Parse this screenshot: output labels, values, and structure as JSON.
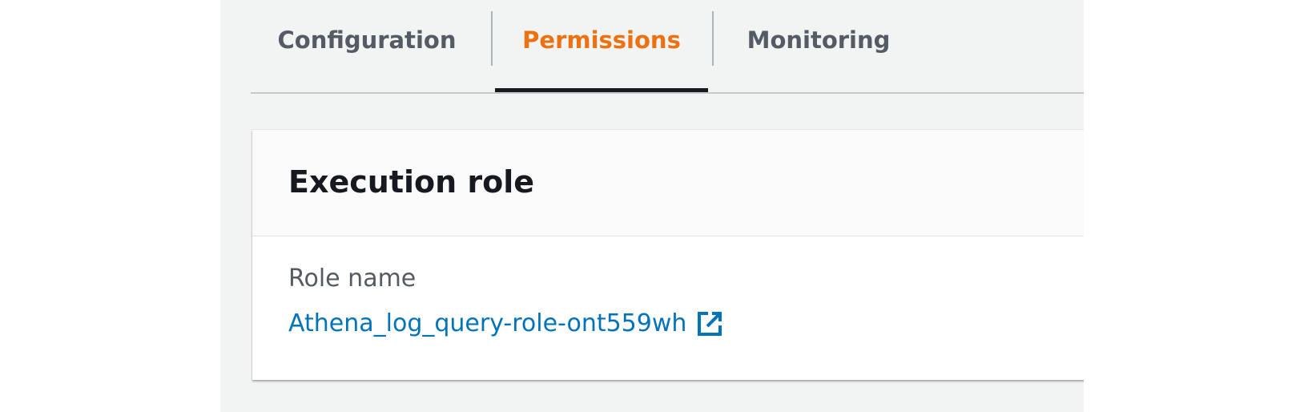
{
  "tabs": [
    {
      "label": "Configuration",
      "active": false
    },
    {
      "label": "Permissions",
      "active": true
    },
    {
      "label": "Monitoring",
      "active": false
    }
  ],
  "execution_role": {
    "title": "Execution role",
    "role_name_label": "Role name",
    "role_name_value": "Athena_log_query-role-ont559wh",
    "link_icon": "external-link-icon"
  },
  "colors": {
    "active_tab": "#ec7211",
    "link": "#0073bb",
    "page_background": "#f2f3f3"
  }
}
